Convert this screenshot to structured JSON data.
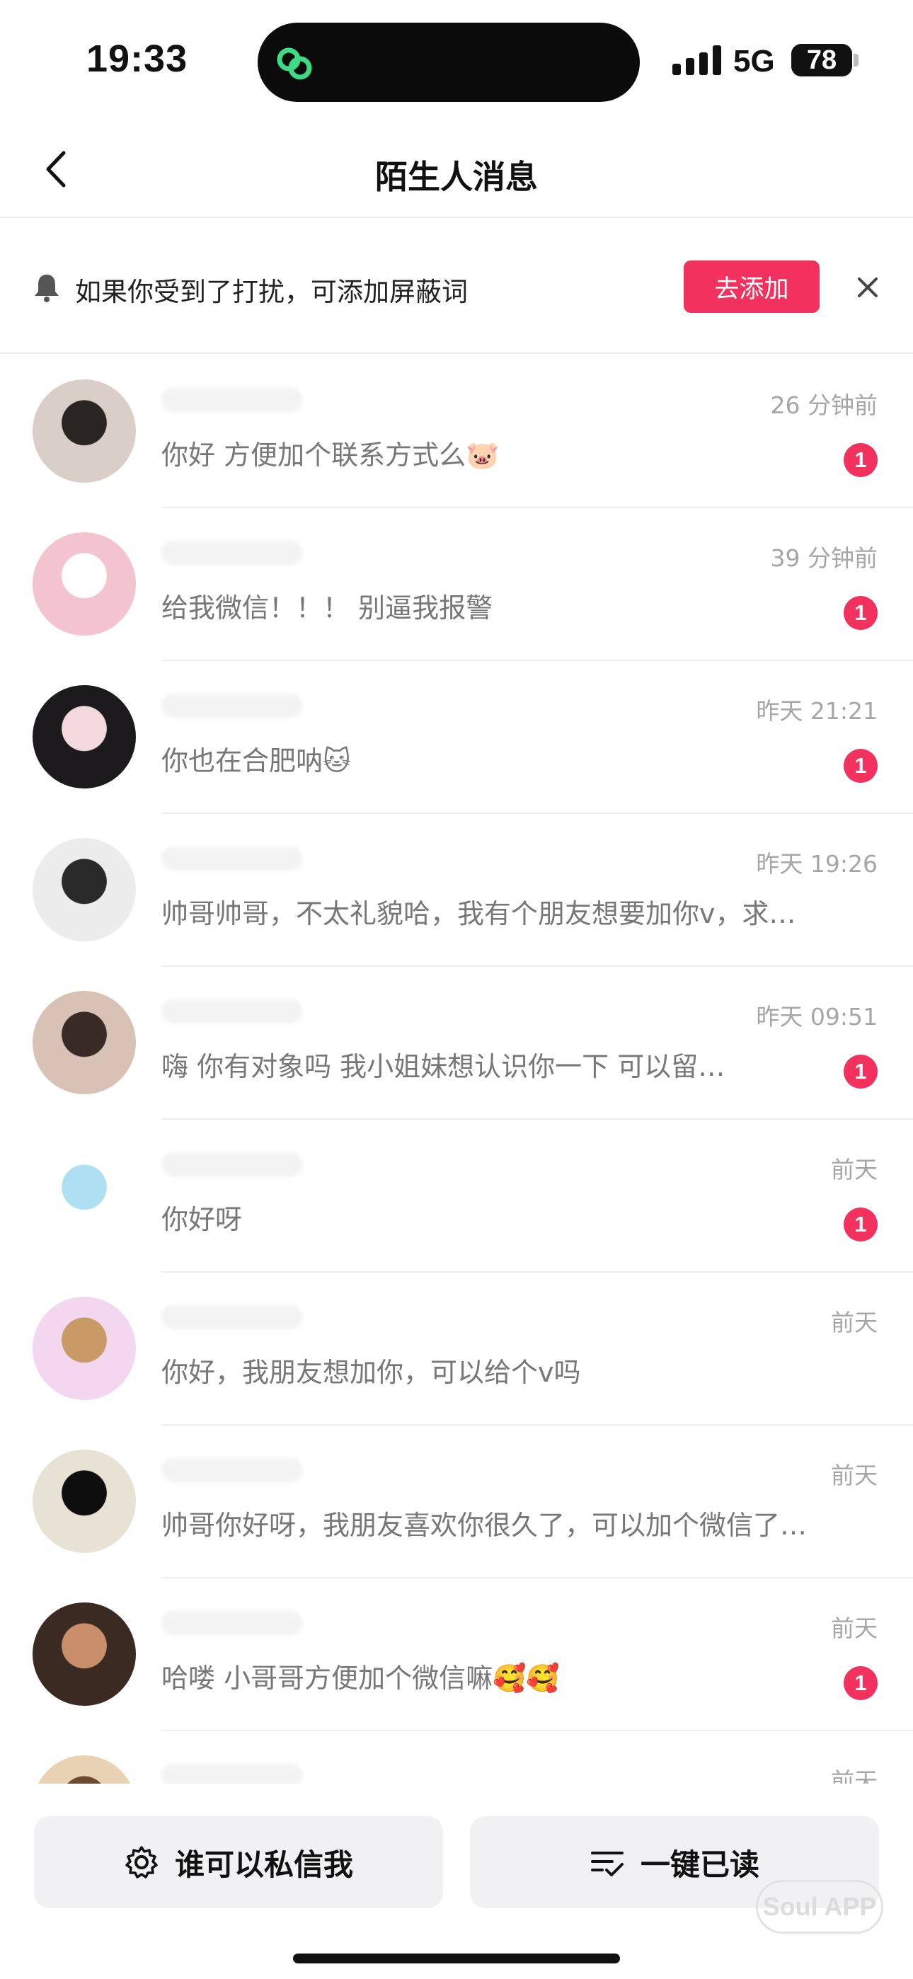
{
  "status_bar": {
    "time": "19:33",
    "network": "5G",
    "battery": "78"
  },
  "nav": {
    "title": "陌生人消息",
    "back_icon": "chevron-left-icon"
  },
  "notice": {
    "text": "如果你受到了打扰，可添加屏蔽词",
    "add_button": "去添加",
    "bell_icon": "bell-icon",
    "close_icon": "close-icon"
  },
  "colors": {
    "accent": "#f2315e",
    "muted": "#a6a6a6",
    "message": "#777777"
  },
  "messages": [
    {
      "time": "26 分钟前",
      "text": "你好 方便加个联系方式么🐷",
      "badge": "1",
      "avatar_color": "#d9cfc8",
      "avatar_accent": "#2b2522"
    },
    {
      "time": "39 分钟前",
      "text": "给我微信！！！ 别逼我报警",
      "badge": "1",
      "avatar_color": "#f3c3cf",
      "avatar_accent": "#ffffff"
    },
    {
      "time": "昨天 21:21",
      "text": "你也在合肥呐🐱",
      "badge": "1",
      "avatar_color": "#1d1a1e",
      "avatar_accent": "#f1d9de"
    },
    {
      "time": "昨天 19:26",
      "text": "帅哥帅哥，不太礼貌哈，我有个朋友想要加你v，求…",
      "badge": "",
      "avatar_color": "#ececec",
      "avatar_accent": "#2a2a2a"
    },
    {
      "time": "昨天 09:51",
      "text": "嗨  你有对象吗  我小姐妹想认识你一下  可以留…",
      "badge": "1",
      "avatar_color": "#d8c2b6",
      "avatar_accent": "#3a2a26"
    },
    {
      "time": "前天",
      "text": "你好呀",
      "badge": "1",
      "avatar_color": "#ffffff",
      "avatar_accent": "#aee0f2"
    },
    {
      "time": "前天",
      "text": "你好，我朋友想加你，可以给个v吗",
      "badge": "",
      "avatar_color": "#f2d7ef",
      "avatar_accent": "#c79a66"
    },
    {
      "time": "前天",
      "text": "帅哥你好呀，我朋友喜欢你很久了，可以加个微信了…",
      "badge": "",
      "avatar_color": "#e7e2d4",
      "avatar_accent": "#0e0e0e"
    },
    {
      "time": "前天",
      "text": "哈喽 小哥哥方便加个微信嘛🥰🥰",
      "badge": "1",
      "avatar_color": "#3a2a22",
      "avatar_accent": "#c98e6a"
    },
    {
      "time": "前天",
      "text": "",
      "badge": "",
      "avatar_color": "#e9d2b4",
      "avatar_accent": "#6b4a2e"
    }
  ],
  "bottom": {
    "privacy_button": "谁可以私信我",
    "read_all_button": "一键已读",
    "gear_icon": "gear-icon",
    "read_icon": "list-check-icon",
    "watermark": "Soul APP"
  }
}
